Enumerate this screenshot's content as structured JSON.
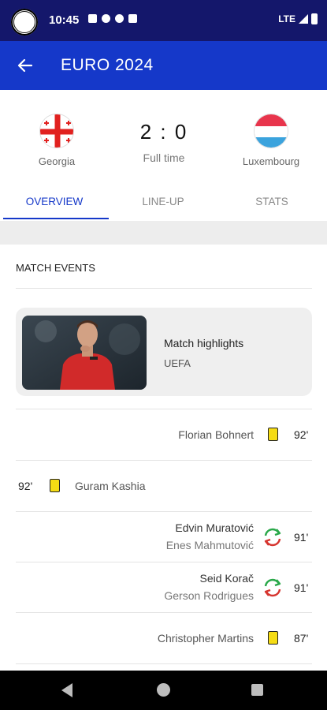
{
  "status_bar": {
    "time": "10:45",
    "network": "LTE"
  },
  "app_bar": {
    "title": "EURO 2024",
    "back_icon": "arrow-left-icon"
  },
  "match": {
    "home_team": "Georgia",
    "away_team": "Luxembourg",
    "score": "2 : 0",
    "status": "Full time"
  },
  "tabs": [
    {
      "label": "OVERVIEW",
      "active": true
    },
    {
      "label": "LINE-UP",
      "active": false
    },
    {
      "label": "STATS",
      "active": false
    }
  ],
  "events_section": {
    "title": "MATCH EVENTS"
  },
  "highlights": {
    "title": "Match highlights",
    "source": "UEFA"
  },
  "events": [
    {
      "side": "away",
      "type": "yellow-card",
      "player": "Florian Bohnert",
      "minute": "92'"
    },
    {
      "side": "home",
      "type": "yellow-card",
      "player": "Guram Kashia",
      "minute": "92'"
    },
    {
      "side": "away",
      "type": "substitution",
      "player_in": "Edvin Muratović",
      "player_out": "Enes Mahmutović",
      "minute": "91'"
    },
    {
      "side": "away",
      "type": "substitution",
      "player_in": "Seid Korač",
      "player_out": "Gerson Rodrigues",
      "minute": "91'"
    },
    {
      "side": "away",
      "type": "yellow-card",
      "player": "Christopher Martins",
      "minute": "87'"
    }
  ],
  "colors": {
    "status_bar": "#14176b",
    "app_bar": "#1538c9",
    "accent": "#1538c9",
    "yellow_card": "#f5dc14",
    "sub_in": "#2aa84a",
    "sub_out": "#d6352f"
  }
}
